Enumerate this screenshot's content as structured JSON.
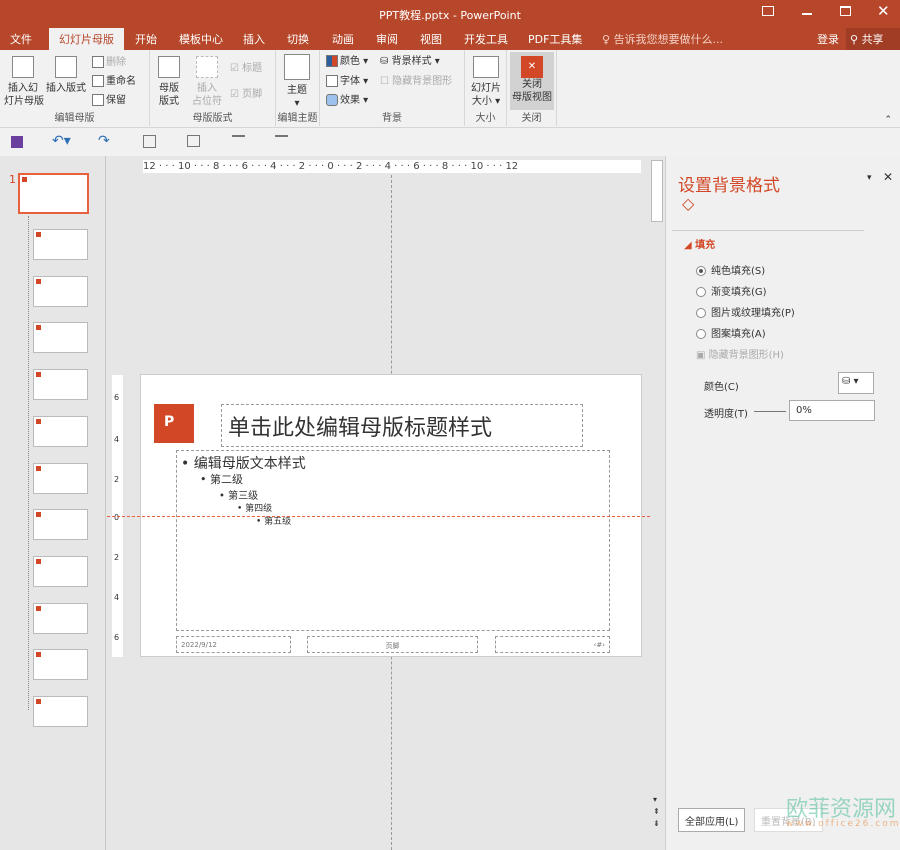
{
  "window": {
    "title": "PPT教程.pptx - PowerPoint",
    "controls": [
      "ribbon-display",
      "minimize",
      "maximize",
      "close"
    ]
  },
  "tabs": [
    "文件",
    "幻灯片母版",
    "开始",
    "模板中心",
    "插入",
    "切换",
    "动画",
    "审阅",
    "视图",
    "开发工具",
    "PDF工具集"
  ],
  "active_tab": "幻灯片母版",
  "tell_me": "告诉我您想要做什么...",
  "signin": "登录",
  "share": "共享",
  "ribbon": {
    "edit_master": {
      "label": "编辑母版",
      "insert_master": "插入幻\n灯片母版",
      "insert_layout": "插入版式",
      "delete": "删除",
      "rename": "重命名",
      "preserve": "保留"
    },
    "master_layout": {
      "label": "母版版式",
      "master_layout_btn": "母版\n版式",
      "insert_placeholder": "插入\n占位符",
      "title_chk": "标题",
      "footer_chk": "页脚"
    },
    "edit_theme": {
      "label": "编辑主题",
      "themes": "主题"
    },
    "background": {
      "label": "背景",
      "colors": "颜色",
      "fonts": "字体",
      "effects": "效果",
      "bg_styles": "背景样式",
      "hide_bg": "隐藏背景图形"
    },
    "size": {
      "label": "大小",
      "slide_size": "幻灯片\n大小"
    },
    "close": {
      "label": "关闭",
      "close_master": "关闭\n母版视图"
    }
  },
  "thumbnails": {
    "selected_number": "1",
    "count": 12
  },
  "ruler": {
    "h": "12 · · · 10 · · · 8 · · · 6 · · · 4 · · · 2 · · · 0 · · · 2 · · · 4 · · · 6 · · · 8 · · · 10 · · · 12",
    "v": [
      "6",
      "4",
      "2",
      "0",
      "2",
      "4",
      "6"
    ]
  },
  "slide": {
    "title": "单击此处编辑母版标题样式",
    "levels": [
      "编辑母版文本样式",
      "第二级",
      "第三级",
      "第四级",
      "第五级"
    ],
    "date": "2022/9/12",
    "footer": "页脚",
    "page": "‹#›",
    "logo_letter": "P"
  },
  "pane": {
    "title": "设置背景格式",
    "section": "填充",
    "options": [
      {
        "label": "纯色填充(S)",
        "checked": true
      },
      {
        "label": "渐变填充(G)",
        "checked": false
      },
      {
        "label": "图片或纹理填充(P)",
        "checked": false
      },
      {
        "label": "图案填充(A)",
        "checked": false
      }
    ],
    "hide_bg": "隐藏背景图形(H)",
    "color_label": "颜色(C)",
    "transparency_label": "透明度(T)",
    "transparency_value": "0%",
    "apply_all": "全部应用(L)",
    "reset": "重置背景(B)"
  },
  "watermark": {
    "name": "欧菲资源网",
    "url": "www.office26.com"
  },
  "colors": {
    "accent": "#b7472a",
    "pane_title": "#d24726"
  }
}
